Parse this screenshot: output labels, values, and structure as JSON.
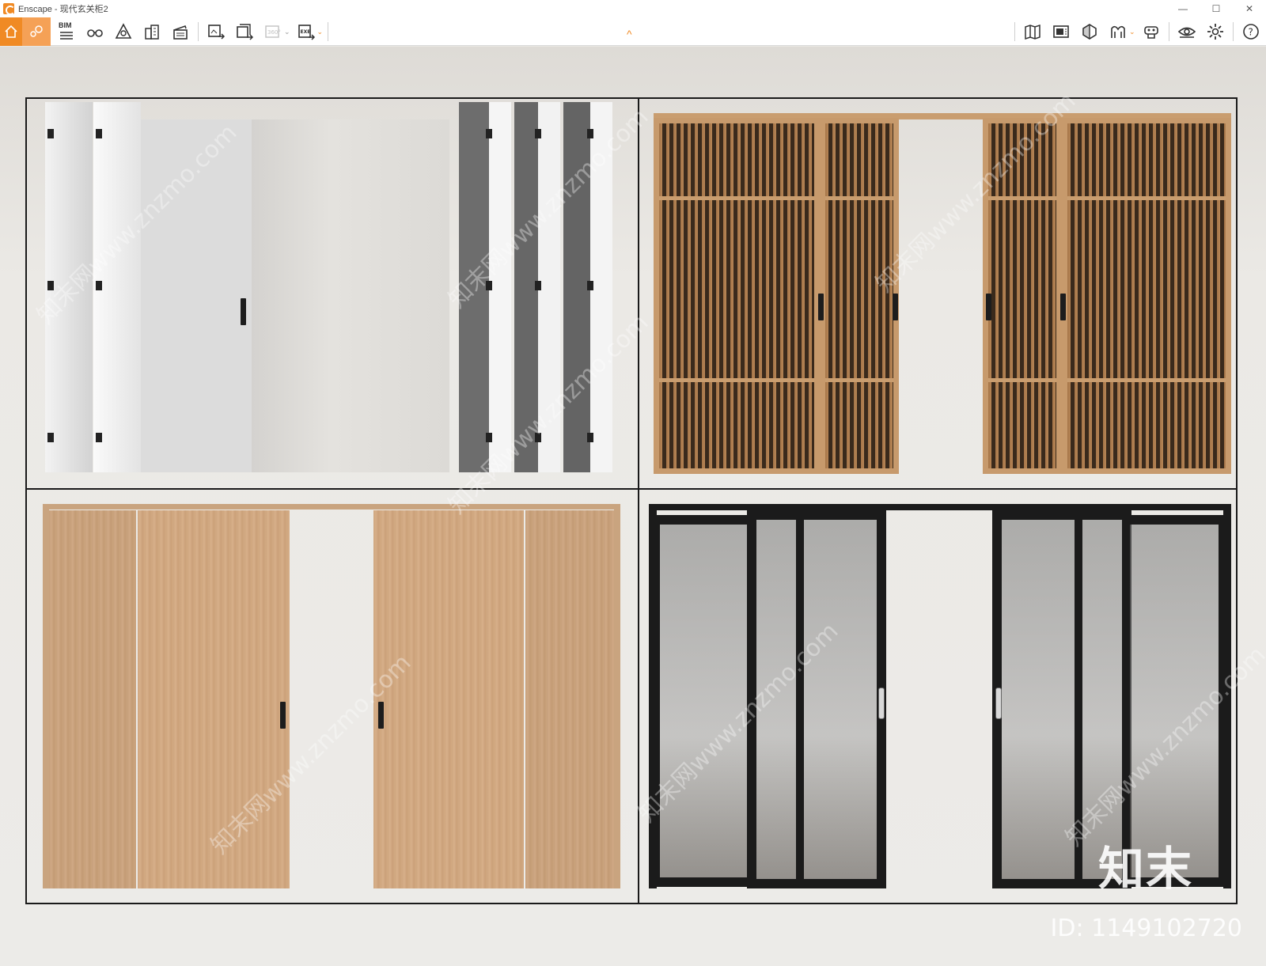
{
  "window": {
    "title": "Enscape - 现代玄关柜2",
    "minimize": "—",
    "maximize": "☐",
    "close": "✕"
  },
  "toolbar": {
    "bim_label": "BIM",
    "caret": "⌄",
    "collapse": "^"
  },
  "watermark": {
    "logo": "知末",
    "id": "ID: 1149102720",
    "diagonal": "知末网www.znzmo.com"
  },
  "colors": {
    "accent": "#f08a24",
    "accent_light": "#f5a156"
  },
  "icons": {
    "home": "home-icon",
    "navigation": "navigation-icon",
    "bim": "bim-icon",
    "binoculars": "binoculars-icon",
    "light-view": "light-view-icon",
    "building": "building-icon",
    "clapper": "video-editor-icon",
    "screenshot": "render-screenshot-icon",
    "batch": "batch-render-icon",
    "pano360": "panorama-360-icon",
    "exe": "export-exe-icon",
    "map": "map-icon",
    "atlas": "atlas-icon",
    "visual": "visual-settings-icon",
    "vr": "vr-headset-icon",
    "asset": "asset-library-icon",
    "eye": "view-icon",
    "gear": "settings-icon",
    "help": "help-icon"
  }
}
